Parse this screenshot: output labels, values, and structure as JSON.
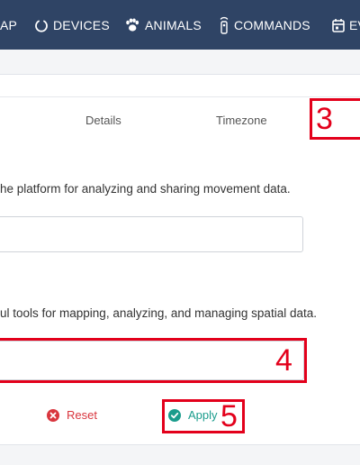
{
  "nav": {
    "items": [
      {
        "label": "AP",
        "icon": "map-icon"
      },
      {
        "label": "DEVICES",
        "icon": "power-icon"
      },
      {
        "label": "ANIMALS",
        "icon": "paw-icon"
      },
      {
        "label": "COMMANDS",
        "icon": "remote-icon"
      },
      {
        "label": "EV",
        "icon": "calendar-icon"
      }
    ]
  },
  "tabs": [
    "Details",
    "Timezone"
  ],
  "sections": {
    "platform_description": "he platform for analyzing and sharing movement data.",
    "platform_input_value": "",
    "gis_description": "ul tools for mapping, analyzing, and managing spatial data.",
    "gis_input_value": ""
  },
  "actions": {
    "reset_label": "Reset",
    "apply_label": "Apply"
  },
  "annotations": [
    "3",
    "4",
    "5"
  ],
  "colors": {
    "navbar": "#2f4465",
    "annotation": "#e3001b",
    "reset": "#d9363e",
    "apply": "#1a9c8c"
  }
}
